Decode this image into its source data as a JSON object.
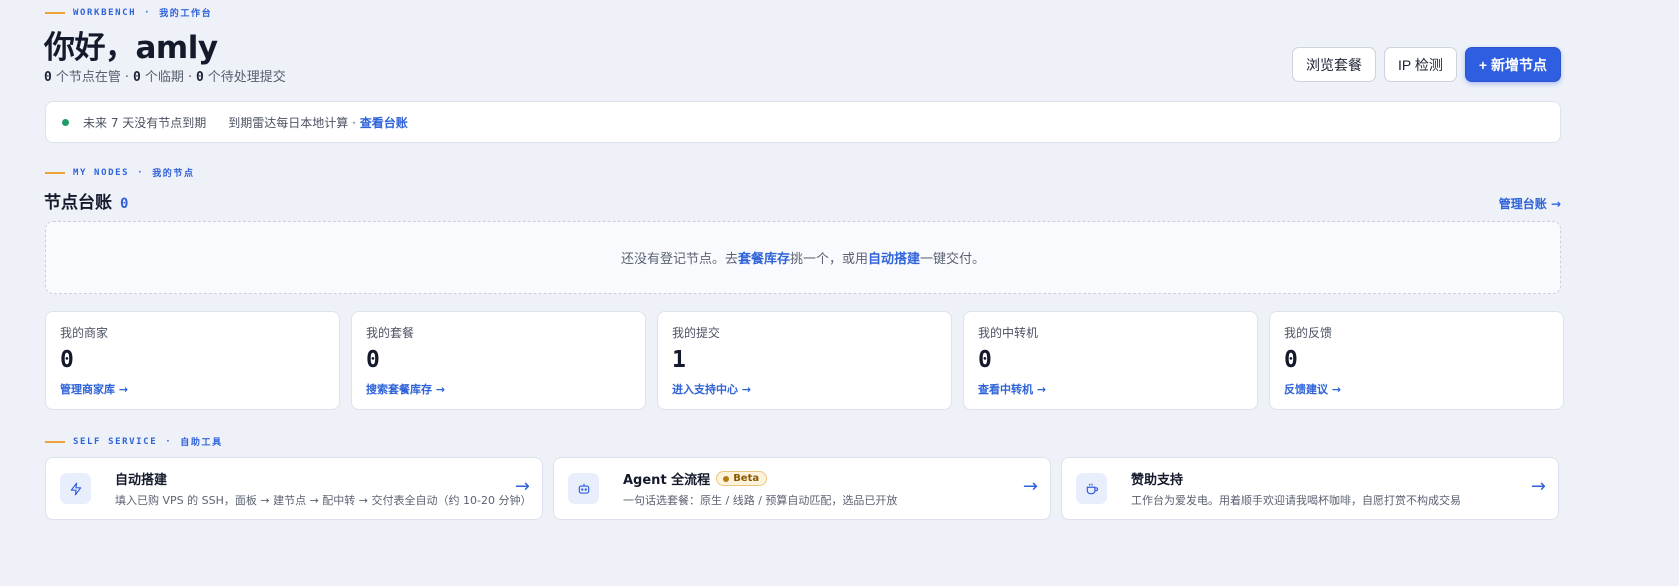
{
  "header": {
    "eyebrow_en": "WORKBENCH",
    "eyebrow_zh": "我的工作台",
    "greeting": "你好，amly",
    "stats": [
      {
        "num": "0",
        "label": "个节点在管"
      },
      {
        "num": "0",
        "label": "个临期"
      },
      {
        "num": "0",
        "label": "个待处理提交"
      }
    ],
    "stat_sep": "·"
  },
  "actions": {
    "browse": "浏览套餐",
    "ip_check": "IP 检测",
    "add_node": "+ 新增节点"
  },
  "notice": {
    "text": "未来 7 天没有节点到期",
    "hint": "到期雷达每日本地计算 · ",
    "link": "查看台账",
    "status_color": "#1f9d67"
  },
  "nodes_section": {
    "eyebrow_en": "MY NODES",
    "eyebrow_zh": "我的节点",
    "title": "节点台账",
    "count": "0",
    "manage_link": "管理台账 →",
    "empty": {
      "pre": "还没有登记节点。去",
      "link1": "套餐库存",
      "mid": "挑一个，或用",
      "link2": "自动搭建",
      "post": "一键交付。"
    }
  },
  "stat_cards": [
    {
      "label": "我的商家",
      "value": "0",
      "link": "管理商家库 →"
    },
    {
      "label": "我的套餐",
      "value": "0",
      "link": "搜索套餐库存 →"
    },
    {
      "label": "我的提交",
      "value": "1",
      "link": "进入支持中心 →"
    },
    {
      "label": "我的中转机",
      "value": "0",
      "link": "查看中转机 →"
    },
    {
      "label": "我的反馈",
      "value": "0",
      "link": "反馈建议 →"
    }
  ],
  "self_service": {
    "eyebrow_en": "SELF SERVICE",
    "eyebrow_zh": "自助工具",
    "tools": [
      {
        "icon": "lightning-icon",
        "title": "自动搭建",
        "badge": "",
        "desc": "填入已购 VPS 的 SSH，面板 → 建节点 → 配中转 → 交付表全自动（约 10-20 分钟）",
        "arrow": "→"
      },
      {
        "icon": "robot-icon",
        "title": "Agent 全流程",
        "badge": "Beta",
        "desc": "一句话选套餐：原生 / 线路 / 预算自动匹配，选品已开放",
        "arrow": "→"
      },
      {
        "icon": "coffee-icon",
        "title": "赞助支持",
        "badge": "",
        "desc": "工作台为爱发电。用着顺手欢迎请我喝杯咖啡，自愿打赏不构成交易",
        "arrow": "→"
      }
    ]
  },
  "colors": {
    "accent": "#2f5fe0",
    "eyebrow_dash": "#f0a23a",
    "background": "#eef1f8"
  }
}
